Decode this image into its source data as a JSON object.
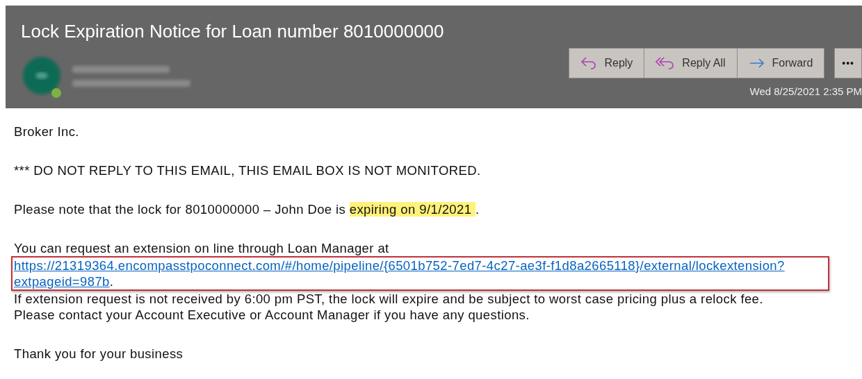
{
  "header": {
    "subject": "Lock Expiration Notice for Loan number 8010000000",
    "actions": [
      {
        "kind": "reply",
        "label": "Reply"
      },
      {
        "kind": "reply-all",
        "label": "Reply All"
      },
      {
        "kind": "forward",
        "label": "Forward"
      }
    ],
    "more": "•••",
    "date": "Wed 8/25/2021 2:35 PM"
  },
  "body": {
    "greeting": "Broker Inc.",
    "warning": "*** DO NOT REPLY TO THIS EMAIL, THIS EMAIL BOX IS NOT MONITORED.",
    "notice": [
      {
        "text": "Please note that the lock for 8010000000 – John Doe is ",
        "highlighted": false
      },
      {
        "text": "expiring on 9/1/2021 ",
        "highlighted": true
      },
      {
        "text": ".",
        "highlighted": false
      }
    ],
    "request_intro": "You can request an extension on line through Loan Manager at",
    "link_lines": [
      "https://21319364.encompasstpoconnect.com/#/home/pipeline/{6501b752-7ed7-4c27-ae3f-f1d8a2665118}/external/lockextension?",
      "extpageid=987b"
    ],
    "link_end": ".",
    "link_boxed": true,
    "deadline": "If extension request is not received by 6:00 pm PST, the lock will expire and be subject to worst case pricing plus a relock fee.",
    "contact": "Please contact your Account Executive or Account Manager if you have any questions.",
    "closing": "Thank you for your business"
  }
}
